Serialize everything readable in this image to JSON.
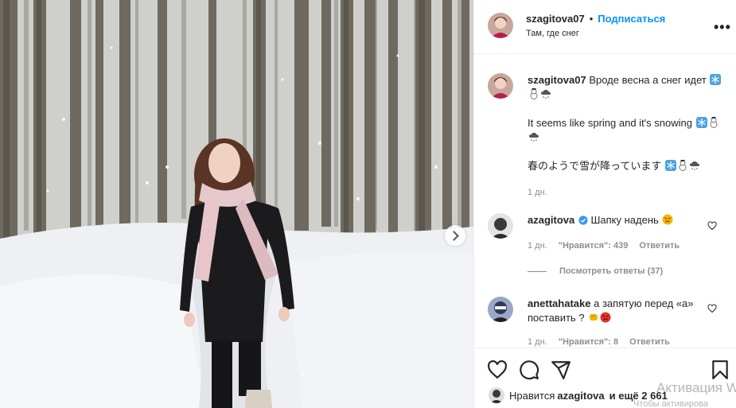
{
  "post": {
    "username": "szagitova07",
    "follow_label": "Подписаться",
    "location": "Там, где снег",
    "more_label": "•••"
  },
  "caption": {
    "username": "szagitova07",
    "line1": "Вроде весна а снег идет",
    "line2": "It seems like spring and it's snowing",
    "line3": "春のようで雪が降っています",
    "time": "1 дн.",
    "emojis": [
      "snowflake-icon",
      "snowman-icon",
      "cloud-snow-icon"
    ]
  },
  "comments": [
    {
      "username": "azagitova",
      "verified": true,
      "text": "Шапку надень",
      "emoji": "angry-face-icon",
      "time": "1 дн.",
      "likes": "\"Нравится\": 439",
      "reply_label": "Ответить",
      "view_replies": "Посмотреть ответы (37)"
    },
    {
      "username": "anettahatake",
      "text": "а запятую перед «а» поставить ?",
      "emojis": [
        "facepunch-icon",
        "rage-face-icon"
      ],
      "time": "1 дн.",
      "likes": "\"Нравится\": 8",
      "reply_label": "Ответить"
    }
  ],
  "actions": {
    "icons": [
      "heart-icon",
      "comment-icon",
      "share-icon",
      "bookmark-icon"
    ]
  },
  "likes_line": {
    "prefix": "Нравится",
    "user": "azagitova",
    "suffix": "и ещё 2 661"
  },
  "watermark": {
    "line1": "Активация Wi",
    "line2": "Чтобы активирова"
  },
  "colors": {
    "accent": "#0095f6",
    "text": "#262626",
    "muted": "#8e8e8e",
    "border": "#efefef"
  }
}
